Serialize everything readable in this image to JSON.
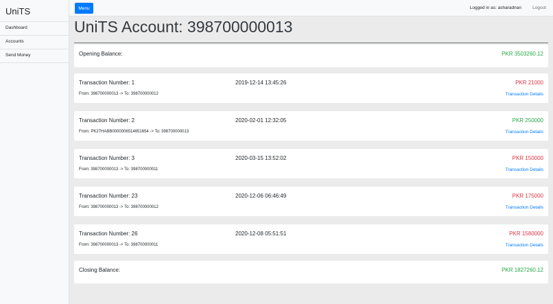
{
  "app": {
    "brand": "UniTS"
  },
  "sidebar": {
    "items": [
      {
        "label": "Dashboard"
      },
      {
        "label": "Accounts"
      },
      {
        "label": "Send Money"
      }
    ]
  },
  "topbar": {
    "menu_label": "Menu",
    "logged_in_text": "Logged in as: asharadnan",
    "logout_label": "Logout"
  },
  "page": {
    "title": "UniTS Account: 398700000013"
  },
  "opening": {
    "label": "Opening Balance:",
    "amount": "PKR 3503260.12",
    "color": "#28a745"
  },
  "transactions": [
    {
      "number": "Transaction Number: 1",
      "date": "2019-12-14 13:45:26",
      "amount": "PKR 21000",
      "route": "From: 398700000013 -> To: 398700000012",
      "details_label": "Transaction Details",
      "type": "debit",
      "color": "#dc3545"
    },
    {
      "number": "Transaction Number: 2",
      "date": "2020-02-01 12:32:05",
      "amount": "PKR 250000",
      "route": "From: PK27HABB0000006514651654 -> To: 398700000013",
      "details_label": "Transaction Details",
      "type": "credit",
      "color": "#28a745"
    },
    {
      "number": "Transaction Number: 3",
      "date": "2020-03-15 13:52:02",
      "amount": "PKR 150000",
      "route": "From: 398700000013 -> To: 398700000011",
      "details_label": "Transaction Details",
      "type": "debit",
      "color": "#dc3545"
    },
    {
      "number": "Transaction Number: 23",
      "date": "2020-12-06 06:46:49",
      "amount": "PKR 175000",
      "route": "From: 398700000013 -> To: 398700000012",
      "details_label": "Transaction Details",
      "type": "debit",
      "color": "#dc3545"
    },
    {
      "number": "Transaction Number: 26",
      "date": "2020-12-08 05:51:51",
      "amount": "PKR 1580000",
      "route": "From: 398700000013 -> To: 398700000011",
      "details_label": "Transaction Details",
      "type": "debit",
      "color": "#dc3545"
    }
  ],
  "closing": {
    "label": "Closing Balance:",
    "amount": "PKR 1827260.12",
    "color": "#28a745"
  },
  "colors": {
    "accent": "#007bff",
    "credit": "#28a745",
    "debit": "#dc3545"
  }
}
